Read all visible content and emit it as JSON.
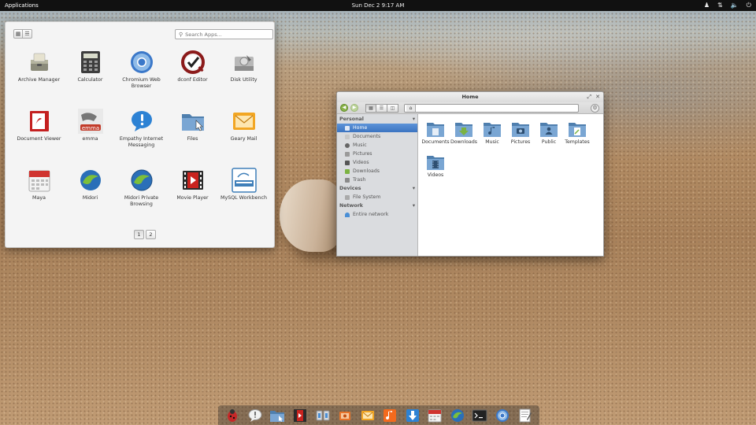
{
  "top_panel": {
    "applications_label": "Applications",
    "clock": "Sun Dec  2  9:17 AM",
    "indicators": [
      "user-icon",
      "network-icon",
      "volume-icon",
      "power-icon"
    ]
  },
  "launcher": {
    "search_placeholder": "Search Apps...",
    "apps": [
      {
        "label": "Archive Manager",
        "icon": "archive-manager-icon"
      },
      {
        "label": "Calculator",
        "icon": "calculator-icon"
      },
      {
        "label": "Chromium Web Browser",
        "icon": "chromium-icon"
      },
      {
        "label": "dconf Editor",
        "icon": "dconf-editor-icon"
      },
      {
        "label": "Disk Utility",
        "icon": "disk-utility-icon"
      },
      {
        "label": "Document Viewer",
        "icon": "document-viewer-icon"
      },
      {
        "label": "emma",
        "icon": "emma-icon"
      },
      {
        "label": "Empathy Internet Messaging",
        "icon": "empathy-icon"
      },
      {
        "label": "Files",
        "icon": "files-icon"
      },
      {
        "label": "Geary Mail",
        "icon": "geary-mail-icon"
      },
      {
        "label": "Maya",
        "icon": "maya-calendar-icon"
      },
      {
        "label": "Midori",
        "icon": "midori-icon"
      },
      {
        "label": "Midori Private Browsing",
        "icon": "midori-private-icon"
      },
      {
        "label": "Movie Player",
        "icon": "movie-player-icon"
      },
      {
        "label": "MySQL Workbench",
        "icon": "mysql-workbench-icon"
      }
    ],
    "pages": [
      "1",
      "2"
    ],
    "current_page": "1"
  },
  "file_manager": {
    "title": "Home",
    "sidebar": {
      "personal_label": "Personal",
      "personal_items": [
        {
          "label": "Home",
          "selected": true
        },
        {
          "label": "Documents"
        },
        {
          "label": "Music"
        },
        {
          "label": "Pictures"
        },
        {
          "label": "Videos"
        },
        {
          "label": "Downloads"
        },
        {
          "label": "Trash"
        }
      ],
      "devices_label": "Devices",
      "devices_items": [
        {
          "label": "File System"
        }
      ],
      "network_label": "Network",
      "network_items": [
        {
          "label": "Entire network"
        }
      ]
    },
    "folders": [
      {
        "label": "Documents",
        "emblem": "documents"
      },
      {
        "label": "Downloads",
        "emblem": "downloads"
      },
      {
        "label": "Music",
        "emblem": "music"
      },
      {
        "label": "Pictures",
        "emblem": "pictures"
      },
      {
        "label": "Public",
        "emblem": "public"
      },
      {
        "label": "Templates",
        "emblem": "templates"
      },
      {
        "label": "Videos",
        "emblem": "videos"
      }
    ]
  },
  "dock": {
    "items": [
      "bug-app-icon",
      "empathy-dock-icon",
      "files-dock-icon",
      "movie-dock-icon",
      "switchboard-dock-icon",
      "photos-dock-icon",
      "mail-dock-icon",
      "music-dock-icon",
      "downloads-dock-icon",
      "calendar-dock-icon",
      "midori-dock-icon",
      "terminal-dock-icon",
      "chromium-dock-icon",
      "text-editor-dock-icon"
    ]
  },
  "colors": {
    "panel": "#111111",
    "selection": "#3b74c1",
    "folder": "#5b86b3"
  }
}
